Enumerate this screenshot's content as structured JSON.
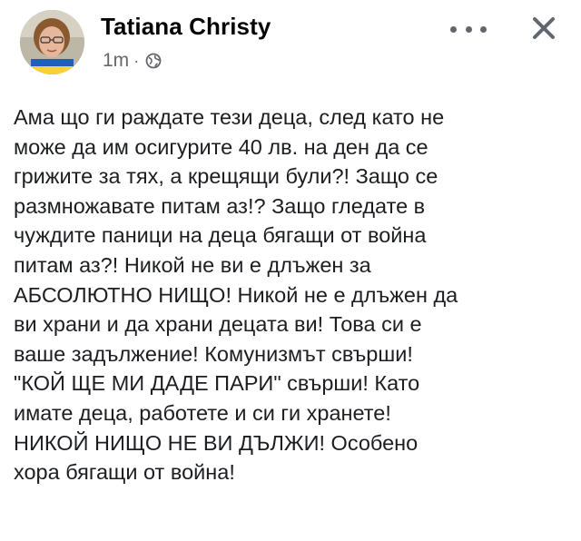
{
  "post": {
    "author_name": "Tatiana Christy",
    "timestamp": "1m",
    "separator": "·",
    "privacy_icon": "globe-icon",
    "avatar_icon": "profile-photo",
    "more_icon": "more-options-icon",
    "close_icon": "close-icon",
    "text": "Ама що ги раждате тези деца, след като не\nможе да им осигурите 40 лв. на ден да се\nгрижите за тях, а крещящи були?! Защо се\nразмножавате питам аз!? Защо гледате в\nчуждите паници на деца бягащи от война\nпитам аз?! Никой не ви е длъжен за\nАБСОЛЮТНО НИЩО! Никой не е длъжен да\nви храни и да храни децата ви! Това си е\nваше задължение! Комунизмът свърши!\n\"КОЙ ЩЕ МИ ДАДЕ ПАРИ\" свърши! Като\nимате деца, работете и си ги хранете!\nНИКОЙ НИЩО НЕ ВИ ДЪЛЖИ! Особено\nхора бягащи от война!"
  },
  "colors": {
    "author": "#050505",
    "meta": "#65676b",
    "body_text": "#1c1e21",
    "icons": "#606770"
  }
}
